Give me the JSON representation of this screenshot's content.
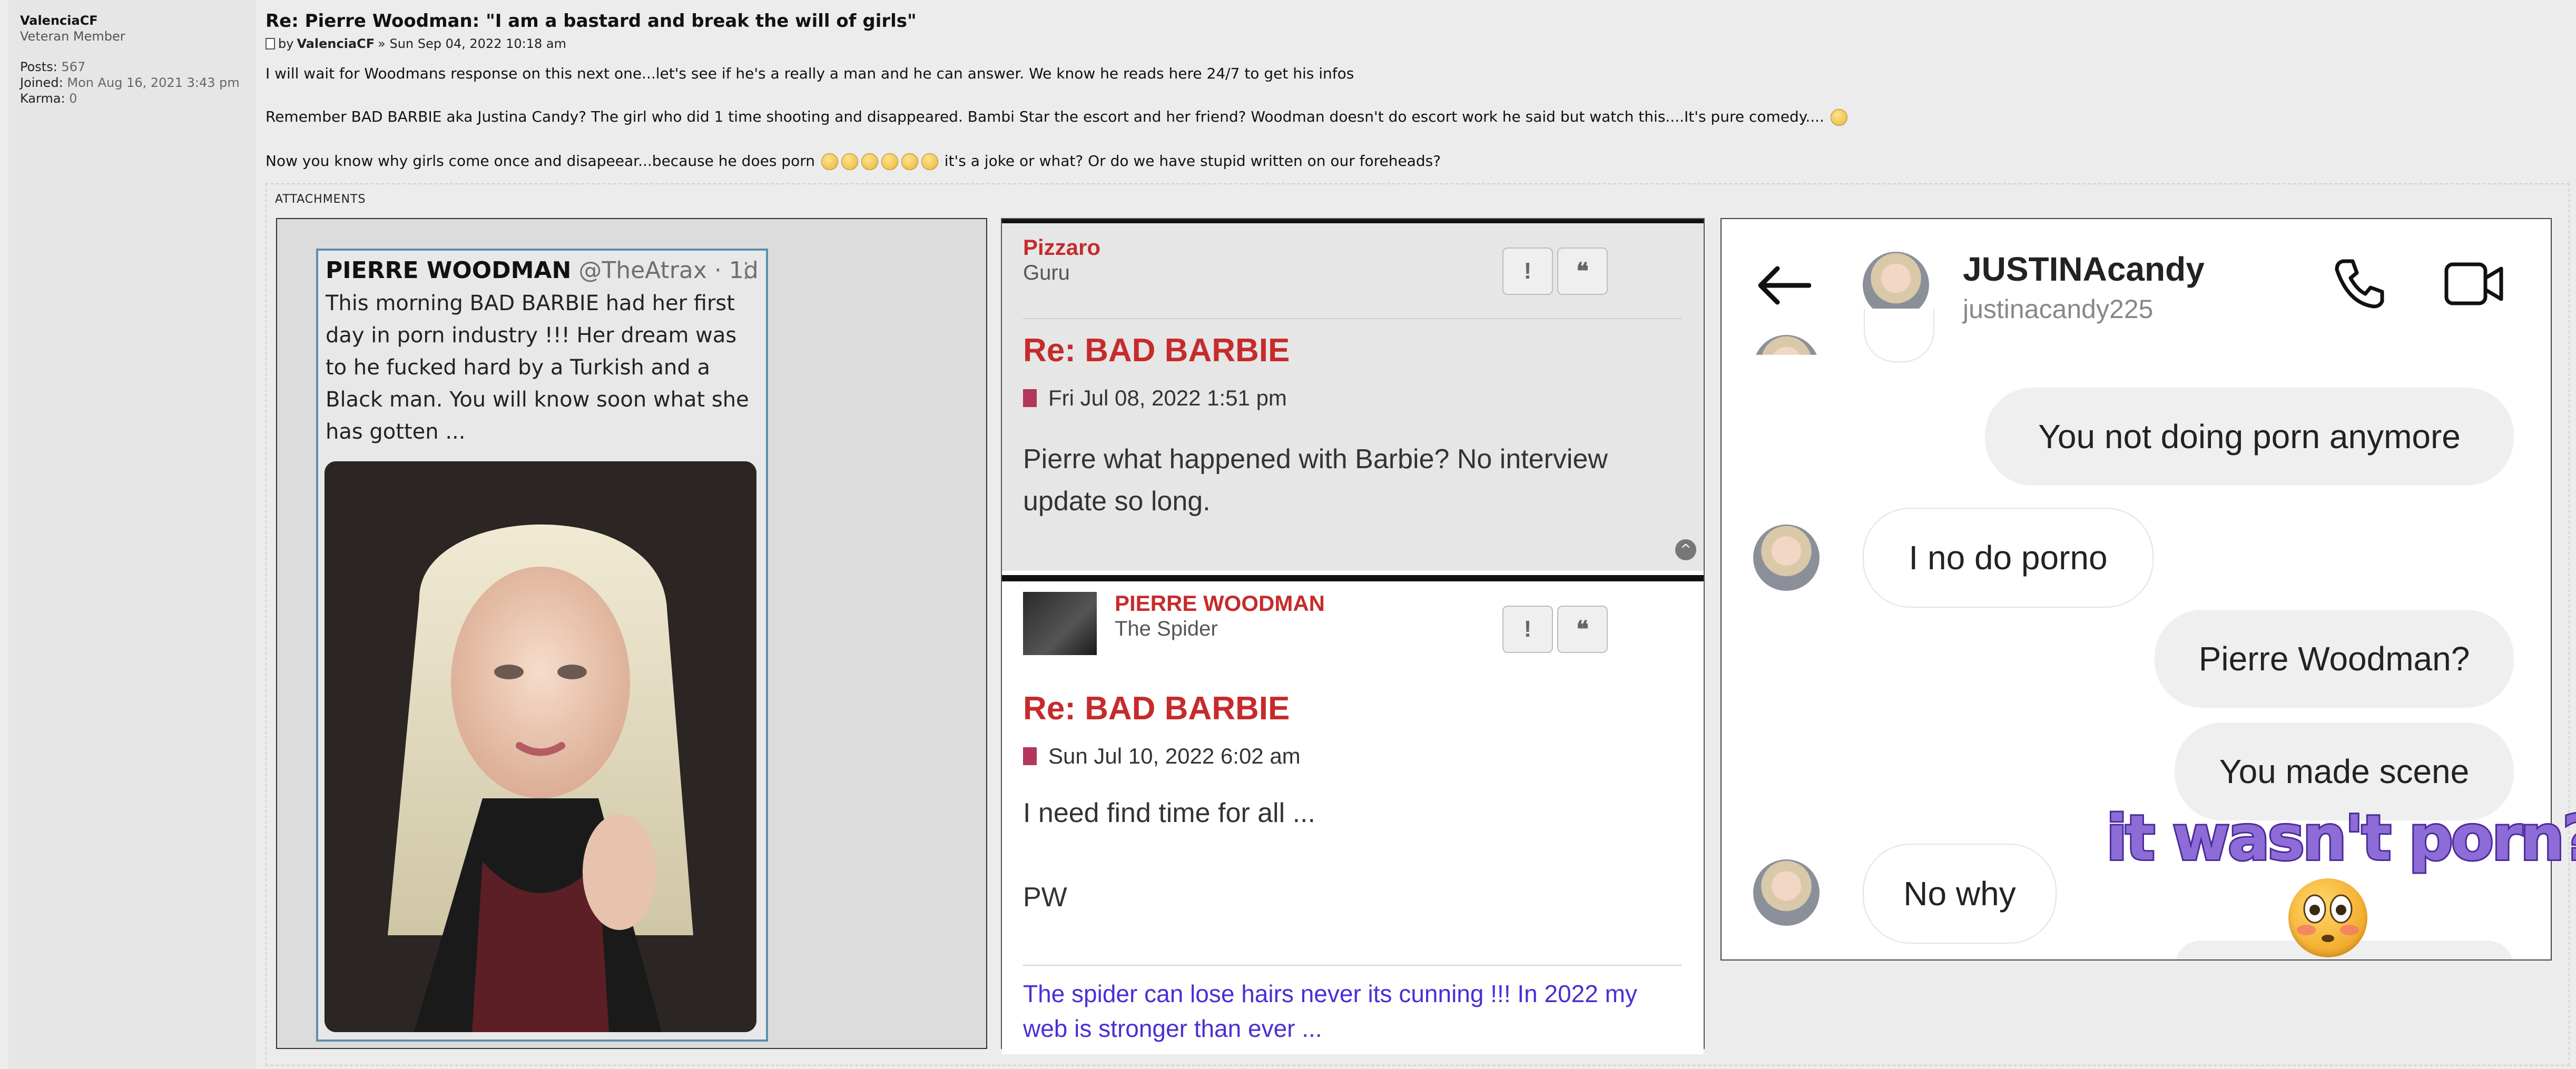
{
  "author": {
    "name": "ValenciaCF",
    "rank": "Veteran Member",
    "posts_label": "Posts:",
    "posts": "567",
    "joined_label": "Joined:",
    "joined": "Mon Aug 16, 2021 3:43 pm",
    "karma_label": "Karma:",
    "karma": "0"
  },
  "post": {
    "title": "Re: Pierre Woodman: \"I am a bastard and break the will of girls\"",
    "by": "by",
    "author": "ValenciaCF",
    "date": "» Sun Sep 04, 2022 10:18 am",
    "line1": "I will wait for Woodmans response on this next one...let's see if he's a really a man and he can answer. We know he reads here 24/7 to get his infos",
    "line2": "Remember BAD BARBIE aka Justina Candy? The girl who did 1 time shooting and disappeared. Bambi Star the escort and her friend? Woodman doesn't do escort work he said but watch this....It's pure comedy....",
    "line3a": "Now you know why girls come once and disapeear...because he does porn",
    "line3b": "it's a joke or what? Or do we have stupid written on our foreheads?"
  },
  "attachments": {
    "label": "ATTACHMENTS"
  },
  "tweet": {
    "name": "PIERRE WOODMAN",
    "handle": "@TheAtrax · 1d",
    "menu": "⋮",
    "text": "This morning BAD BARBIE had her first day in porn industry !!! Her dream was to he fucked hard by a Turkish and a Black man. You will know soon what she has gotten ..."
  },
  "forum": {
    "post1": {
      "user": "Pizzaro",
      "rank": "Guru",
      "title": "Re: BAD BARBIE",
      "date": "Fri Jul 08, 2022 1:51 pm",
      "body": "Pierre what happened with Barbie? No interview update so long."
    },
    "post2": {
      "user": "PIERRE WOODMAN",
      "rank": "The Spider",
      "title": "Re: BAD BARBIE",
      "date": "Sun Jul 10, 2022 6:02 am",
      "body1": "I need find time for all ...",
      "body2": "PW",
      "signature": "The spider can lose hairs never its cunning !!! In 2022 my web is stronger than ever ..."
    },
    "report_label": "!",
    "quote_label": "❝"
  },
  "chat": {
    "name": "JUSTINAcandy",
    "username": "justinacandy225",
    "messages": [
      {
        "dir": "out",
        "text": "You not doing porn anymore"
      },
      {
        "dir": "in",
        "text": "I no do porno"
      },
      {
        "dir": "out",
        "text": "Pierre Woodman?"
      },
      {
        "dir": "out",
        "text": "You made scene"
      },
      {
        "dir": "in",
        "text": "No why"
      }
    ],
    "overlay": "it wasn't porn?"
  }
}
